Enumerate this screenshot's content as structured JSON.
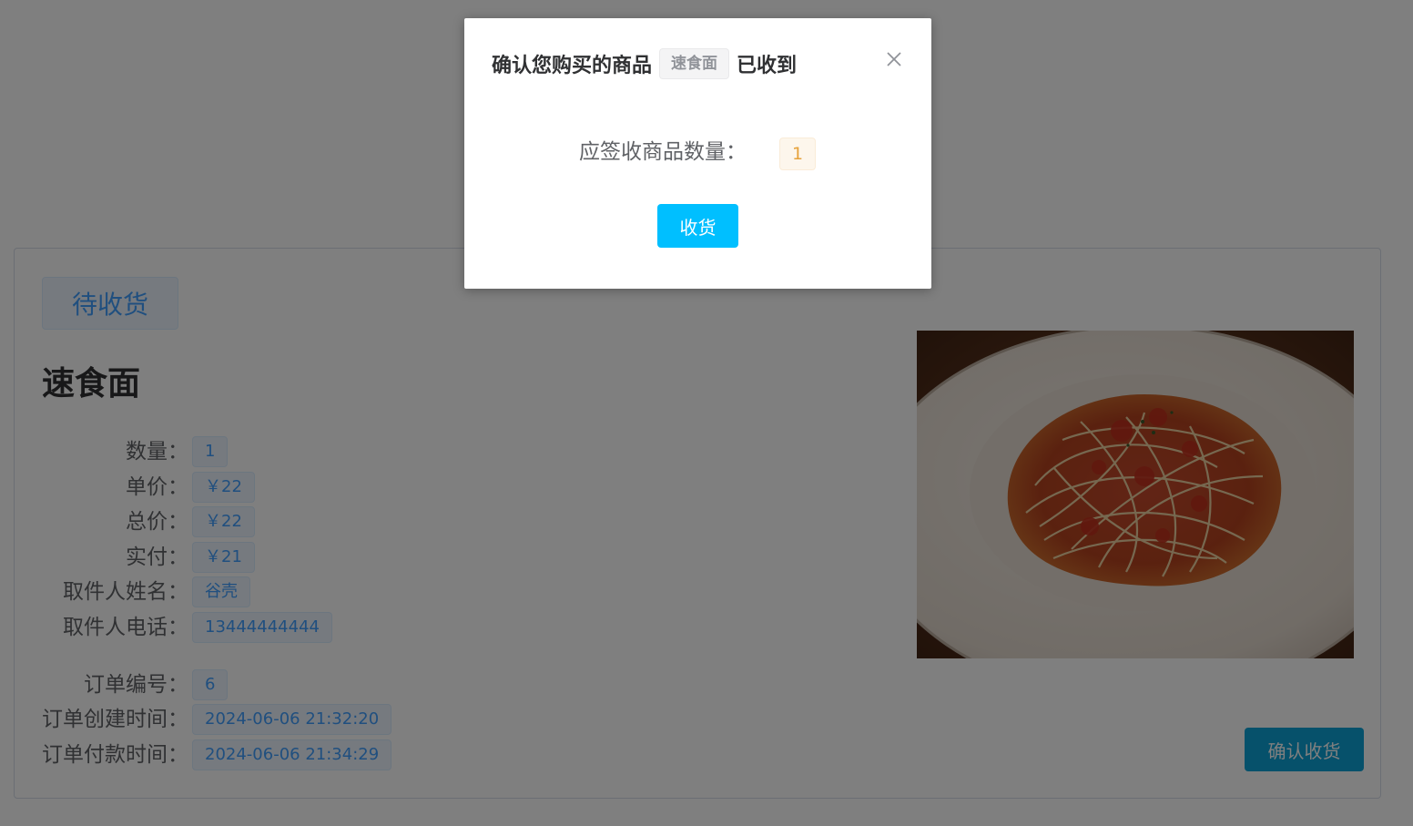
{
  "order": {
    "status": "待收货",
    "product_name": "速食面",
    "image_alt": "spaghetti-with-tomato-sauce",
    "details": [
      {
        "label": "数量：",
        "value": "1"
      },
      {
        "label": "单价：",
        "value": "￥22"
      },
      {
        "label": "总价：",
        "value": "￥22"
      },
      {
        "label": "实付：",
        "value": "￥21"
      },
      {
        "label": "取件人姓名：",
        "value": "谷壳"
      },
      {
        "label": "取件人电话：",
        "value": "13444444444"
      }
    ],
    "meta": [
      {
        "label": "订单编号：",
        "value": "6"
      },
      {
        "label": "订单创建时间：",
        "value": "2024-06-06 21:32:20"
      },
      {
        "label": "订单付款时间：",
        "value": "2024-06-06 21:34:29"
      }
    ],
    "confirm_button": "确认收货"
  },
  "dialog": {
    "title_prefix": "确认您购买的商品",
    "title_tag": "速食面",
    "title_suffix": "已收到",
    "close_icon": "close-icon",
    "quantity_label": "应签收商品数量：",
    "quantity_value": "1",
    "receive_button": "收货"
  },
  "colors": {
    "primary": "#409eff",
    "receive_button": "#00bfff",
    "warning_tag": "#e6a23c",
    "mask": "rgba(0,0,0,0.5)"
  }
}
